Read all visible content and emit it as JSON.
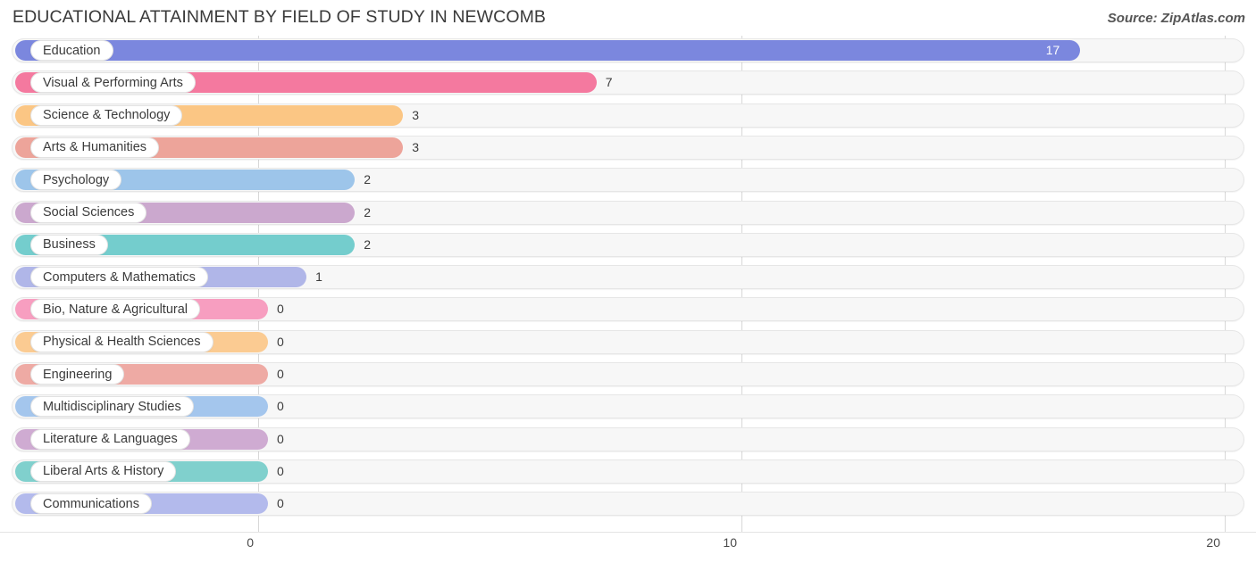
{
  "header": {
    "title": "EDUCATIONAL ATTAINMENT BY FIELD OF STUDY IN NEWCOMB",
    "source": "Source: ZipAtlas.com"
  },
  "chart_data": {
    "type": "bar",
    "orientation": "horizontal",
    "title": "EDUCATIONAL ATTAINMENT BY FIELD OF STUDY IN NEWCOMB",
    "xlabel": "",
    "ylabel": "",
    "xlim": [
      0,
      20
    ],
    "xticks": [
      "0",
      "10",
      "20"
    ],
    "xtick_values": [
      0,
      10,
      20
    ],
    "grid": true,
    "legend": false,
    "categories": [
      "Education",
      "Visual & Performing Arts",
      "Science & Technology",
      "Arts & Humanities",
      "Psychology",
      "Social Sciences",
      "Business",
      "Computers & Mathematics",
      "Bio, Nature & Agricultural",
      "Physical & Health Sciences",
      "Engineering",
      "Multidisciplinary Studies",
      "Literature & Languages",
      "Liberal Arts & History",
      "Communications"
    ],
    "values": [
      17,
      7,
      3,
      3,
      2,
      2,
      2,
      1,
      0,
      0,
      0,
      0,
      0,
      0,
      0
    ],
    "value_labels": [
      "17",
      "7",
      "3",
      "3",
      "2",
      "2",
      "2",
      "1",
      "0",
      "0",
      "0",
      "0",
      "0",
      "0",
      "0"
    ],
    "colors": [
      "#7b87de",
      "#f4799f",
      "#fbc684",
      "#eda49a",
      "#9dc5ea",
      "#cba8ce",
      "#74cdcd",
      "#b0b6e8",
      "#f79ec0",
      "#fbcb92",
      "#eeaaa4",
      "#a4c6ed",
      "#cfabd2",
      "#80d0cd",
      "#b3baec"
    ]
  }
}
